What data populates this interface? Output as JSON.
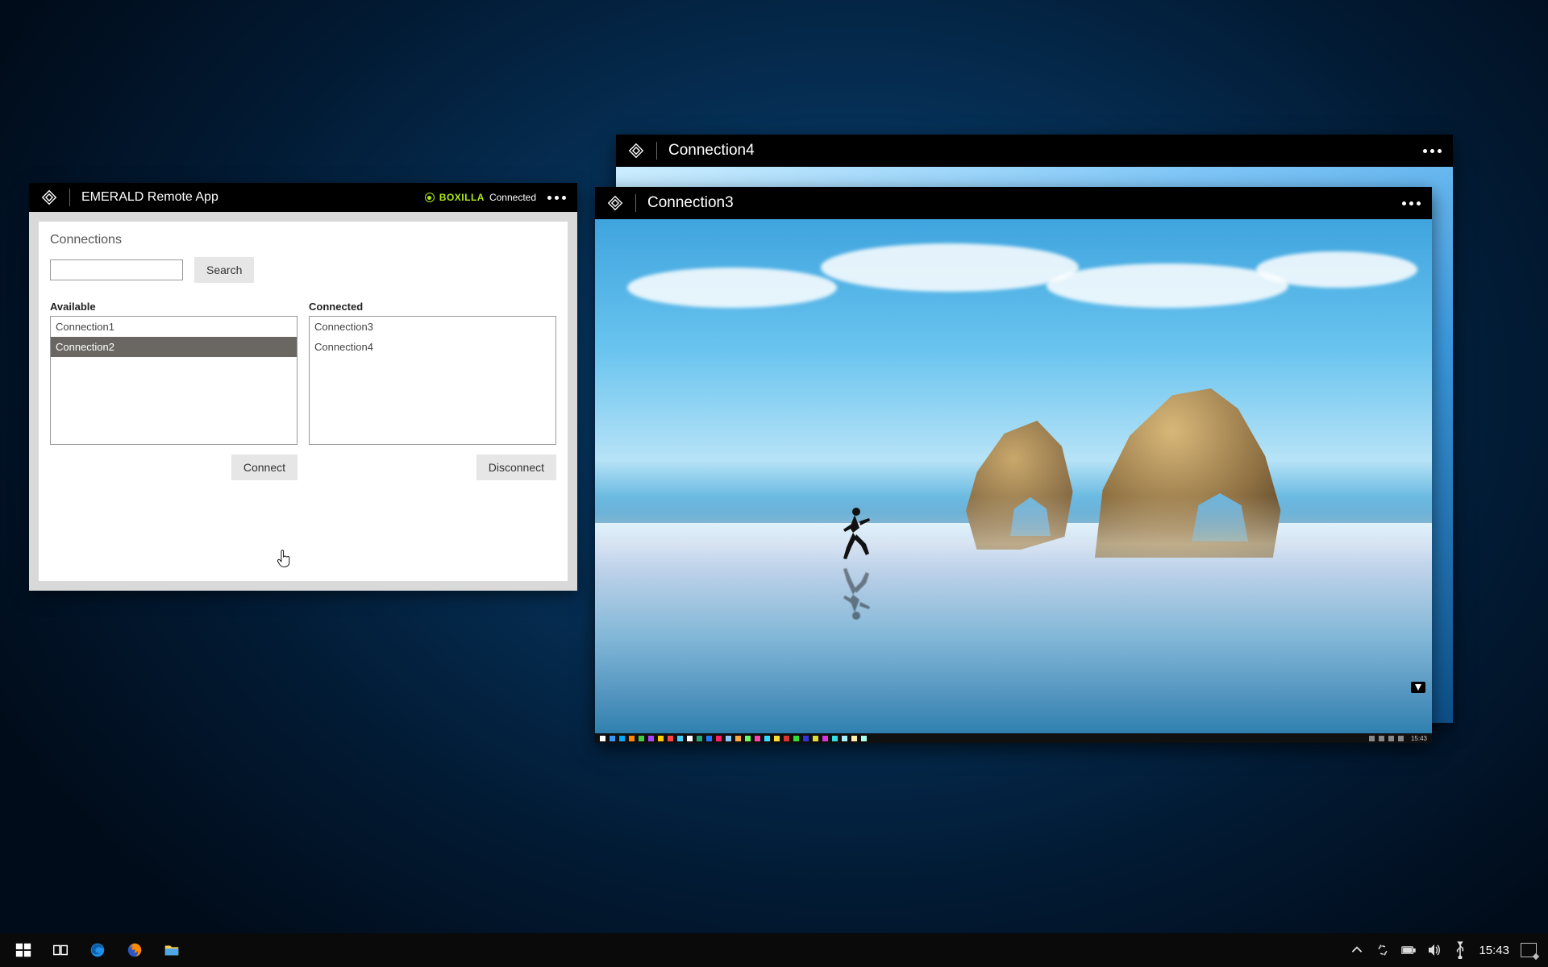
{
  "emerald": {
    "title": "EMERALD Remote App",
    "status_brand": "BOXILLA",
    "status_text": "Connected",
    "section_title": "Connections",
    "search_button": "Search",
    "available_label": "Available",
    "connected_label": "Connected",
    "available": [
      "Connection1",
      "Connection2"
    ],
    "available_selected_index": 1,
    "connected": [
      "Connection3",
      "Connection4"
    ],
    "connect_button": "Connect",
    "disconnect_button": "Disconnect"
  },
  "remote_windows": {
    "win4_title": "Connection4",
    "win3_title": "Connection3",
    "inner_clock": "15:43"
  },
  "taskbar": {
    "clock": "15:43"
  },
  "colors": {
    "accent_green": "#aee818"
  }
}
